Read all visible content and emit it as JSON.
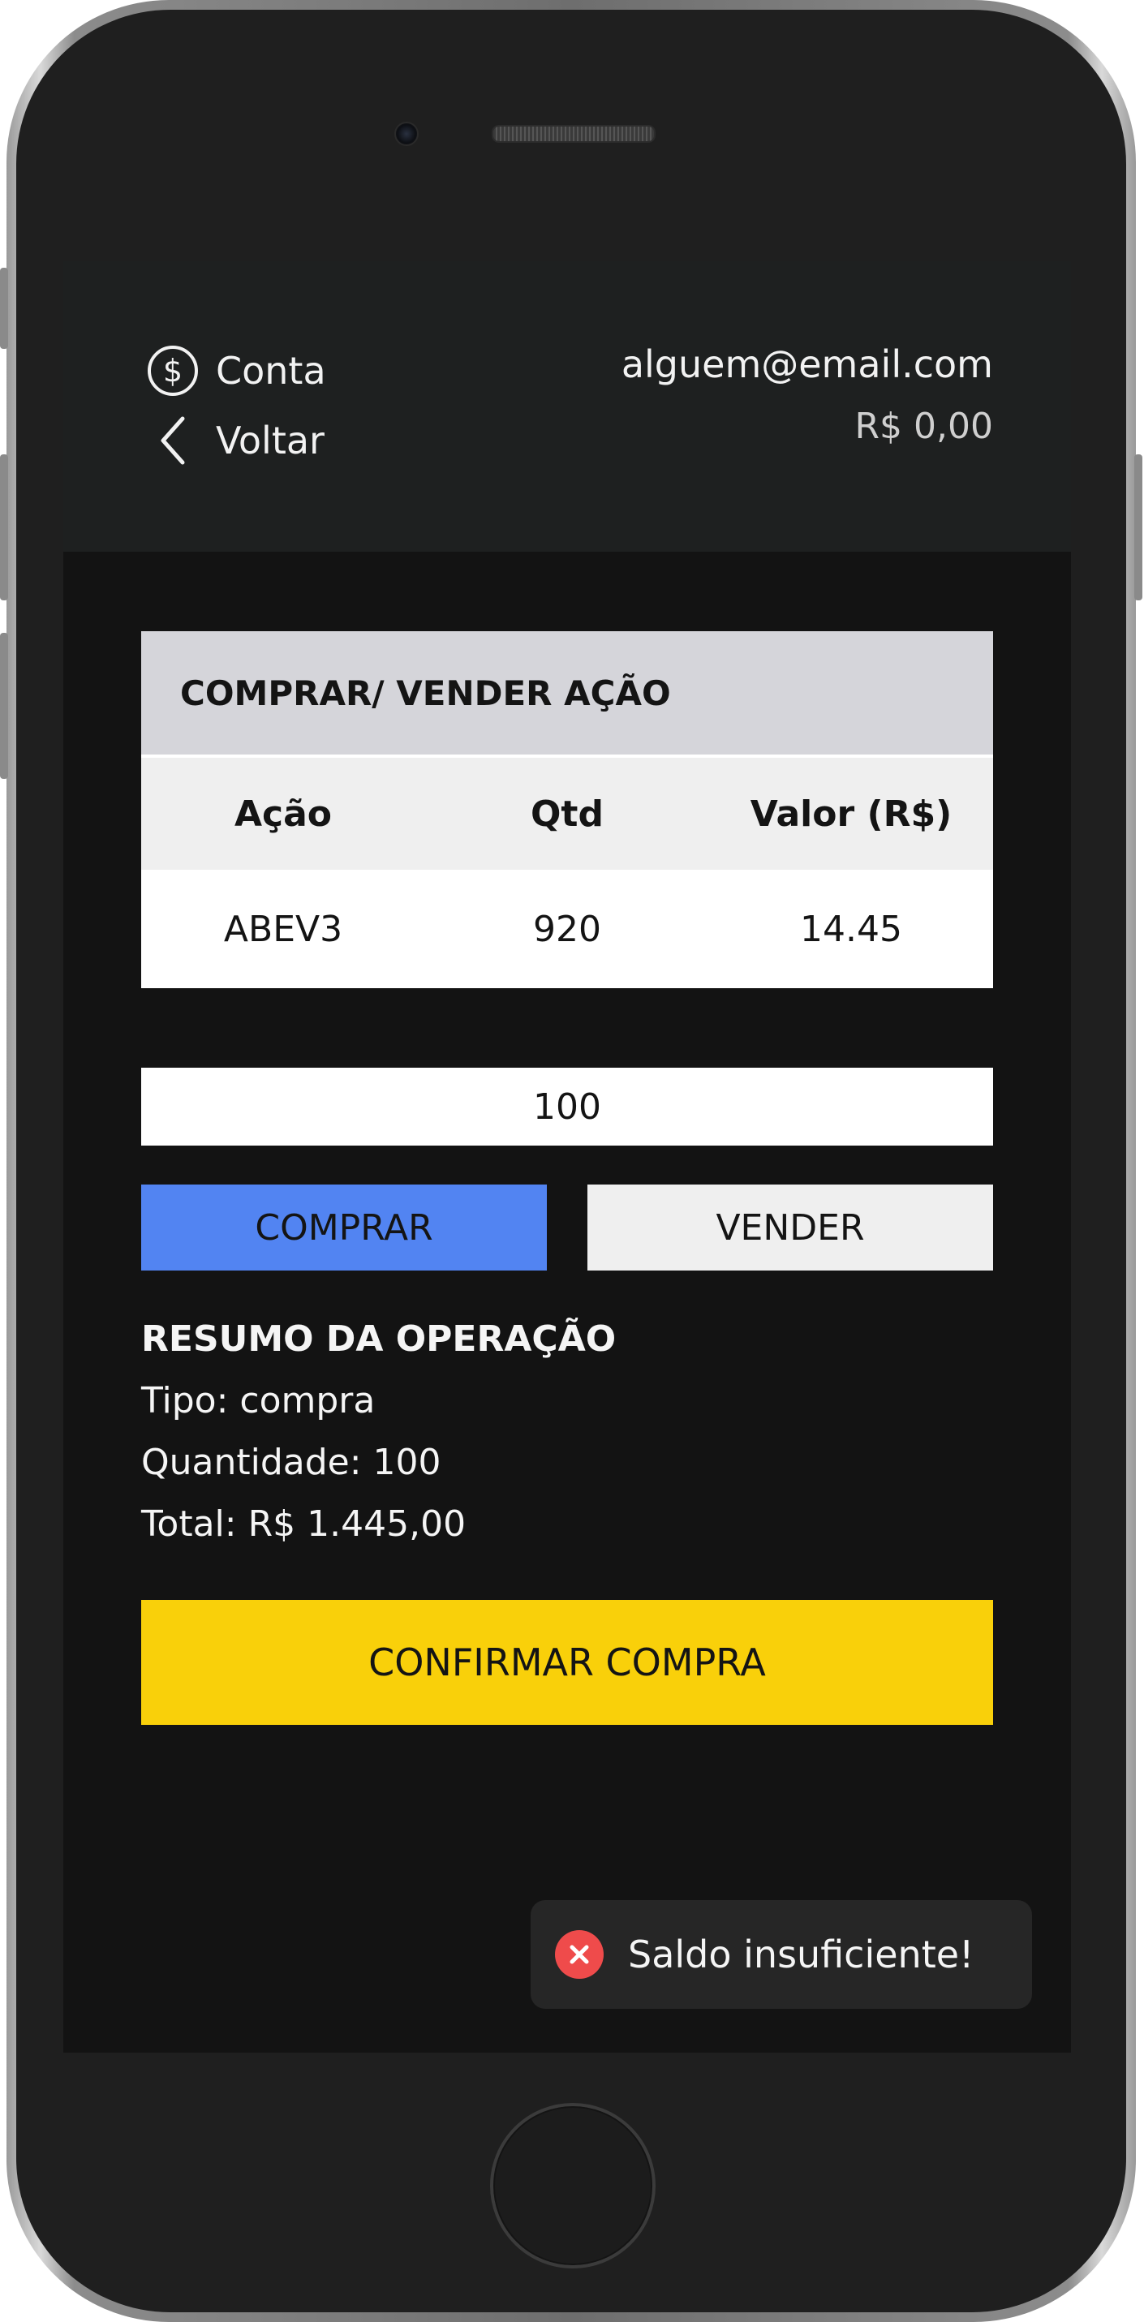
{
  "header": {
    "account_label": "Conta",
    "back_label": "Voltar",
    "email": "alguem@email.com",
    "balance": "R$ 0,00"
  },
  "card": {
    "title": "COMPRAR/ VENDER AÇÃO",
    "columns": [
      "Ação",
      "Qtd",
      "Valor (R$)"
    ],
    "row": [
      "ABEV3",
      "920",
      "14.45"
    ]
  },
  "order": {
    "quantity_value": "100",
    "buy_label": "COMPRAR",
    "sell_label": "VENDER"
  },
  "summary": {
    "title": "RESUMO DA OPERAÇÃO",
    "type_line": "Tipo: compra",
    "qty_line": "Quantidade: 100",
    "total_line": "Total: R$ 1.445,00"
  },
  "confirm_label": "CONFIRMAR COMPRA",
  "toast": {
    "message": "Saldo insuficiente!"
  },
  "colors": {
    "buy_button": "#5284f2",
    "confirm_button": "#f9d00a",
    "toast_error": "#ef4b4b"
  },
  "icons": {
    "account": "dollar-circle-icon",
    "back": "chevron-left-icon",
    "toast": "error-x-icon"
  }
}
